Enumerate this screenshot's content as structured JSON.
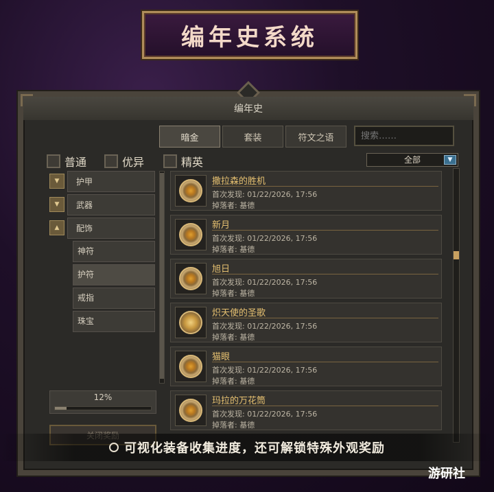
{
  "banner": {
    "title": "编年史系统"
  },
  "panel": {
    "header_title": "编年史"
  },
  "tabs": [
    {
      "label": "暗金",
      "active": true
    },
    {
      "label": "套装",
      "active": false
    },
    {
      "label": "符文之语",
      "active": false
    }
  ],
  "search": {
    "placeholder": "搜索……"
  },
  "rarity_filters": [
    {
      "label": "普通"
    },
    {
      "label": "优异"
    },
    {
      "label": "精英"
    }
  ],
  "dropdown": {
    "selected": "全部",
    "arrow_icon": "▼"
  },
  "categories": [
    {
      "label": "护甲",
      "toggle_icon": "▼"
    },
    {
      "label": "武器",
      "toggle_icon": "▼"
    },
    {
      "label": "配饰",
      "toggle_icon": "▲"
    }
  ],
  "subcategories": [
    {
      "label": "神符",
      "selected": false
    },
    {
      "label": "护符",
      "selected": true
    },
    {
      "label": "戒指",
      "selected": false
    },
    {
      "label": "珠宝",
      "selected": false
    }
  ],
  "progress": {
    "label": "12%",
    "value": 0.12
  },
  "close_rewards_button": {
    "label": "关闭奖励"
  },
  "items": [
    {
      "name": "撒拉森的胜机",
      "date": "首次发现: 01/22/2026, 17:56",
      "drop": "掉落者: 基德"
    },
    {
      "name": "新月",
      "date": "首次发现: 01/22/2026, 17:56",
      "drop": "掉落者: 基德"
    },
    {
      "name": "旭日",
      "date": "首次发现: 01/22/2026, 17:56",
      "drop": "掉落者: 基德"
    },
    {
      "name": "炽天使的圣歌",
      "date": "首次发现: 01/22/2026, 17:56",
      "drop": "掉落者: 基德"
    },
    {
      "name": "猫眼",
      "date": "首次发现: 01/22/2026, 17:56",
      "drop": "掉落者: 基德"
    },
    {
      "name": "玛拉的万花筒",
      "date": "首次发现: 01/22/2026, 17:56",
      "drop": "掉落者: 基德"
    }
  ],
  "caption": {
    "text": "可视化装备收集进度，还可解锁特殊外观奖励"
  },
  "watermark": {
    "text": "游研社"
  },
  "colors": {
    "accent_gold": "#e6c070",
    "banner_border": "#b08d5a",
    "background_purple": "#1e0f28"
  }
}
